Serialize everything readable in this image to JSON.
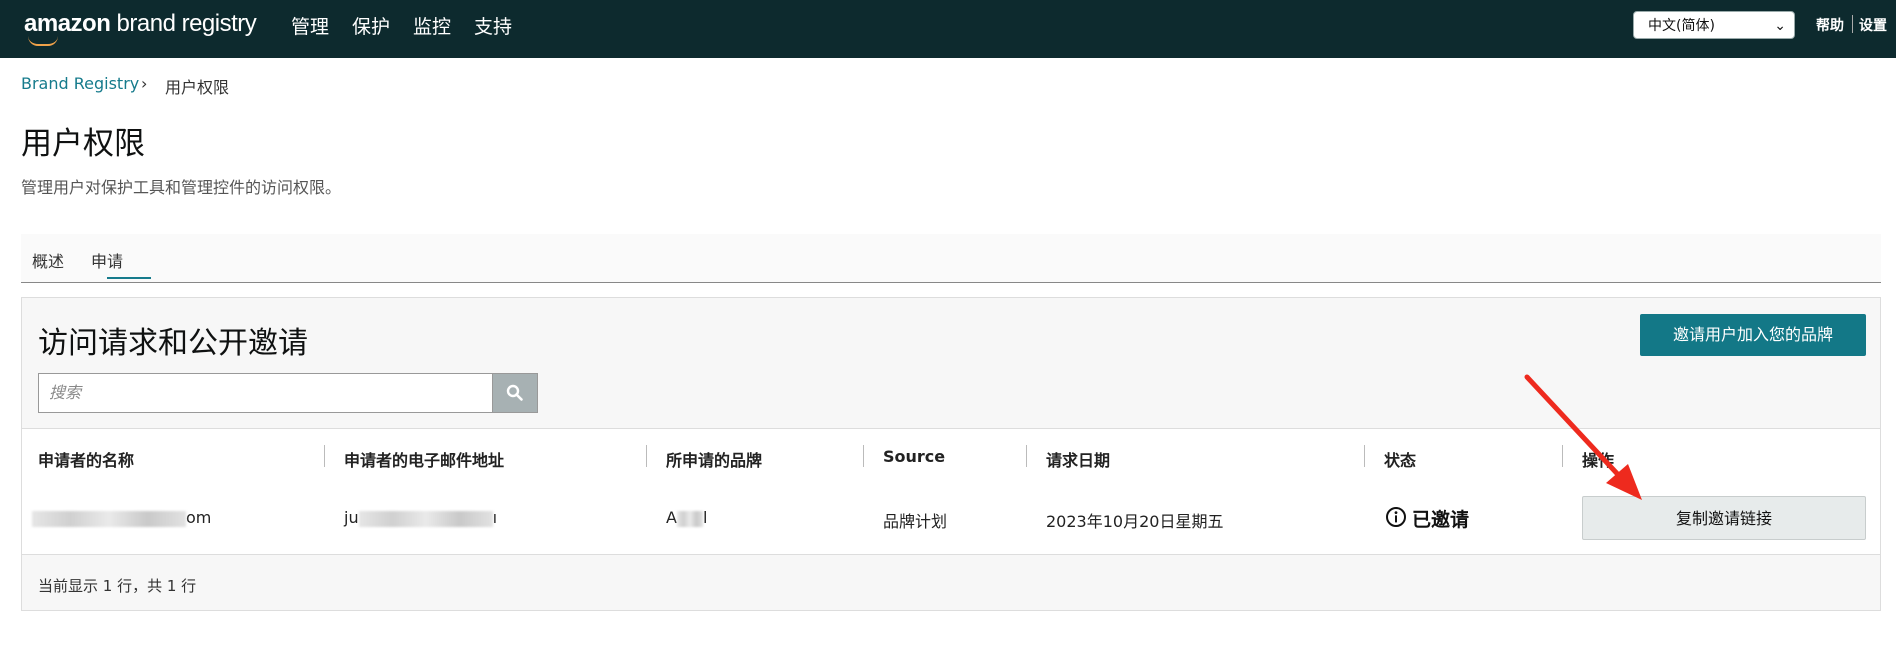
{
  "topbar": {
    "logo_prefix": "amazon",
    "logo_suffix": " brand registry",
    "nav": [
      "管理",
      "保护",
      "监控",
      "支持"
    ],
    "language": "中文(简体)",
    "help": "帮助",
    "settings": "设置"
  },
  "breadcrumb": {
    "root": "Brand Registry",
    "current": "用户权限"
  },
  "page": {
    "title": "用户权限",
    "subtitle": "管理用户对保护工具和管理控件的访问权限。"
  },
  "tabs": [
    "概述",
    "申请"
  ],
  "panel": {
    "title": "访问请求和公开邀请",
    "invite_button": "邀请用户加入您的品牌",
    "search_placeholder": "搜索"
  },
  "table": {
    "headers": [
      "申请者的名称",
      "申请者的电子邮件地址",
      "所申请的品牌",
      "Source",
      "请求日期",
      "状态",
      "操作"
    ],
    "row": {
      "name_tail": "om",
      "email_head": "ju",
      "email_tail": "ı",
      "brand_head": "A",
      "brand_tail": "l",
      "source": "品牌计划",
      "date": "2023年10月20日星期五",
      "status": "已邀请",
      "action": "复制邀请链接"
    },
    "footer": "当前显示 1 行，共 1 行"
  },
  "colors": {
    "topbar": "#0d2a2e",
    "accent": "#137887",
    "annotation_arrow": "#ee2a1e"
  }
}
